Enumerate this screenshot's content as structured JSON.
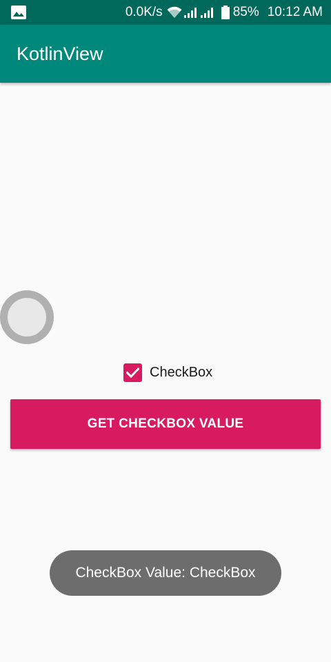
{
  "status_bar": {
    "net_speed": "0.0K/s",
    "battery_percent": "85%",
    "time": "10:12 AM",
    "icons": [
      "gallery-icon",
      "wifi-icon",
      "signal-icon",
      "signal-icon",
      "battery-icon"
    ],
    "color": "#00695c"
  },
  "app_bar": {
    "title": "KotlinView",
    "color": "#00897b"
  },
  "checkbox": {
    "label": "CheckBox",
    "checked": true,
    "color": "#d81b60"
  },
  "button": {
    "label": "GET CHECKBOX VALUE",
    "color": "#d81b60"
  },
  "toast": {
    "text": "CheckBox Value: CheckBox"
  }
}
